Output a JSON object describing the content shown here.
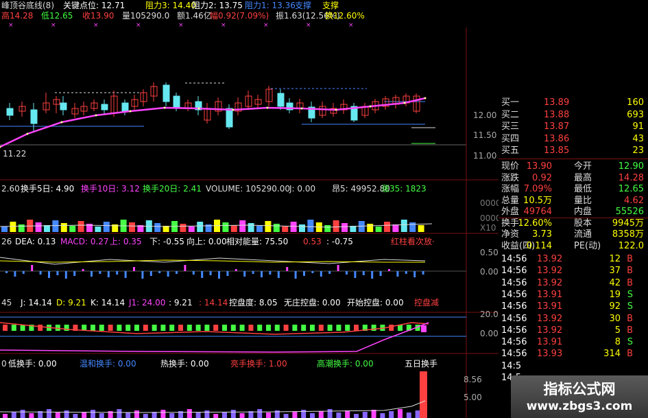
{
  "header": {
    "line1": [
      {
        "text": "峰顶谷底线(8)",
        "color": "#dddddd"
      },
      {
        "text": "关键点位: 12.71",
        "color": "#ffffff"
      },
      {
        "text": "阻力3: 14.40",
        "color": "#ffff00"
      },
      {
        "text": "阻力2: 13.75",
        "color": "#ffffff"
      },
      {
        "text": "阻力1: 13.36",
        "color": "#4488ff"
      },
      {
        "text": "支撑",
        "color": "#4488ff"
      },
      {
        "text": "支撑",
        "color": "#ffff00"
      }
    ],
    "line2": [
      {
        "text": "高14.28",
        "color": "#ff4040"
      },
      {
        "text": "低12.65",
        "color": "#40ff40"
      },
      {
        "text": "收13.90",
        "color": "#ff4040"
      },
      {
        "text": "量105290.0",
        "color": "#dddddd"
      },
      {
        "text": "额1.46亿",
        "color": "#dddddd"
      },
      {
        "text": "幅0.92(7.09%)",
        "color": "#ff4040"
      },
      {
        "text": "振1.63(12.56%)",
        "color": "#dddddd"
      },
      {
        "text": "换12.60%",
        "color": "#ffff00"
      }
    ]
  },
  "price_axis": {
    "labels": [
      "12.00",
      "11.50",
      "11.00"
    ]
  },
  "price_low_label": "11.22",
  "indicator_bar1": {
    "items": [
      {
        "text": "2.60",
        "color": "#dddddd"
      },
      {
        "text": "换手5日: 4.90",
        "color": "#ffffff"
      },
      {
        "text": "换手10日: 3.12",
        "color": "#ff44ff"
      },
      {
        "text": "换手20日: 2.41",
        "color": "#44ff44"
      },
      {
        "text": "VOLUME: 105290.00",
        "color": "#dddddd"
      },
      {
        "text": "J: 0.00",
        "color": "#dddddd"
      },
      {
        "text": "昂5: 49952.80",
        "color": "#dddddd"
      },
      {
        "text": "涨35: 1823",
        "color": "#44ff44"
      }
    ]
  },
  "vol_axis": {
    "labels": [
      "0000",
      "0000",
      "X10"
    ]
  },
  "macd_bar": {
    "items": [
      {
        "text": "26",
        "color": "#dddddd"
      },
      {
        "text": "DEA: 0.13",
        "color": "#ffffff"
      },
      {
        "text": "MACD: 0.27",
        "color": "#ff44ff"
      },
      {
        "text": "上: 0.35",
        "color": "#ff44ff"
      },
      {
        "text": "下: -0.55",
        "color": "#ffffff"
      },
      {
        "text": "向上: 0.00",
        "color": "#ffffff"
      },
      {
        "text": "相对能量: 75.50",
        "color": "#ffffff"
      },
      {
        "text": "0.53",
        "color": "#ff4040"
      },
      {
        "text": ": -0.75",
        "color": "#ffffff"
      },
      {
        "text": "红柱看次放·",
        "color": "#ff4040"
      }
    ]
  },
  "macd_axis": {
    "labels": [
      "0.50",
      "0.00"
    ]
  },
  "kdj_bar": {
    "items": [
      {
        "text": "45",
        "color": "#dddddd"
      },
      {
        "text": "J: 14.14",
        "color": "#ffffff"
      },
      {
        "text": "D: 9.21",
        "color": "#ffff00"
      },
      {
        "text": "K: 14.14",
        "color": "#ffffff"
      },
      {
        "text": "J1: 24.00",
        "color": "#ff44ff"
      },
      {
        "text": ": 9.21",
        "color": "#ffffff"
      },
      {
        "text": ": 14.14",
        "color": "#ff4040"
      },
      {
        "text": "控盘度: 8.05",
        "color": "#ffffff"
      },
      {
        "text": "无庄控盘: 0.00",
        "color": "#ffffff"
      },
      {
        "text": "开始控盘: 0.00",
        "color": "#ffffff"
      },
      {
        "text": "控盘减",
        "color": "#ff4040"
      }
    ]
  },
  "kdj_axis": {
    "labels": [
      "20.00",
      "0.00"
    ]
  },
  "turnover_bar": {
    "items": [
      {
        "text": "0",
        "color": "#dddddd"
      },
      {
        "text": "低换手: 0.00",
        "color": "#ffffff"
      },
      {
        "text": "温和换手: 0.00",
        "color": "#4488ff"
      },
      {
        "text": "热换手: 0.00",
        "color": "#ffffff"
      },
      {
        "text": "亮手换手: 1.00",
        "color": "#ff4040"
      },
      {
        "text": "高潮换手: 0.00",
        "color": "#44ff44"
      },
      {
        "text": "五日换手",
        "color": "#ffffff"
      }
    ]
  },
  "turnover_axis": {
    "labels": [
      "8.56",
      "5.00"
    ]
  },
  "order_book": [
    {
      "label": "买一",
      "price": "13.89",
      "vol": "160"
    },
    {
      "label": "买二",
      "price": "13.88",
      "vol": "693"
    },
    {
      "label": "买三",
      "price": "13.87",
      "vol": "91"
    },
    {
      "label": "买四",
      "price": "13.86",
      "vol": "43"
    },
    {
      "label": "买五",
      "price": "13.85",
      "vol": "23"
    }
  ],
  "quote_rows": [
    {
      "l1": "现价",
      "v1": "13.90",
      "c1": "#ff4040",
      "l2": "今开",
      "v2": "12.90",
      "c2": "#44ff44"
    },
    {
      "l1": "涨跌",
      "v1": "0.92",
      "c1": "#ff4040",
      "l2": "最高",
      "v2": "14.28",
      "c2": "#ff4040"
    },
    {
      "l1": "涨幅",
      "v1": "7.09%",
      "c1": "#ff4040",
      "l2": "最低",
      "v2": "12.65",
      "c2": "#44ff44"
    },
    {
      "l1": "总量",
      "v1": "10.5万",
      "c1": "#ffff00",
      "l2": "量比",
      "v2": "4.62",
      "c2": "#ff4040"
    },
    {
      "l1": "外盘",
      "v1": "49764",
      "c1": "#ff4040",
      "l2": "内盘",
      "v2": "55526",
      "c2": "#44ff44"
    },
    {
      "l1": "换手",
      "v1": "12.60%",
      "c1": "#ffff00",
      "l2": "股本",
      "v2": "9945万",
      "c2": "#ffff00"
    },
    {
      "l1": "净资",
      "v1": "3.73",
      "c1": "#ffff00",
      "l2": "流通",
      "v2": "8358万",
      "c2": "#ffff00"
    },
    {
      "l1": "收益(四)",
      "v1": "0.114",
      "c1": "#ffff00",
      "l2": "PE(动)",
      "v2": "122.0",
      "c2": "#ffff00"
    }
  ],
  "ticks": [
    {
      "time": "14:56",
      "price": "13.92",
      "vol": "12",
      "side": "B"
    },
    {
      "time": "14:56",
      "price": "13.92",
      "vol": "37",
      "side": "B"
    },
    {
      "time": "14:56",
      "price": "13.92",
      "vol": "42",
      "side": "B"
    },
    {
      "time": "14:56",
      "price": "13.91",
      "vol": "19",
      "side": "S"
    },
    {
      "time": "14:56",
      "price": "13.91",
      "vol": "92",
      "side": "S"
    },
    {
      "time": "14:56",
      "price": "13.92",
      "vol": "30",
      "side": "B"
    },
    {
      "time": "14:56",
      "price": "13.92",
      "vol": "5",
      "side": "B"
    },
    {
      "time": "14:56",
      "price": "13.91",
      "vol": "8",
      "side": "S"
    },
    {
      "time": "14:56",
      "price": "13.93",
      "vol": "314",
      "side": "B"
    },
    {
      "time": "14:5",
      "price": "",
      "vol": "",
      "side": ""
    },
    {
      "time": "14:5",
      "price": "",
      "vol": "",
      "side": ""
    }
  ],
  "watermark": {
    "title": "指标公式网",
    "url": "www.zbgs3.com"
  },
  "colors": {
    "up": "#ff4040",
    "down": "#44ff44",
    "cyan": "#66e8f0",
    "magenta": "#ff44ff",
    "yellow": "#ffff00",
    "blue": "#4488ff"
  }
}
